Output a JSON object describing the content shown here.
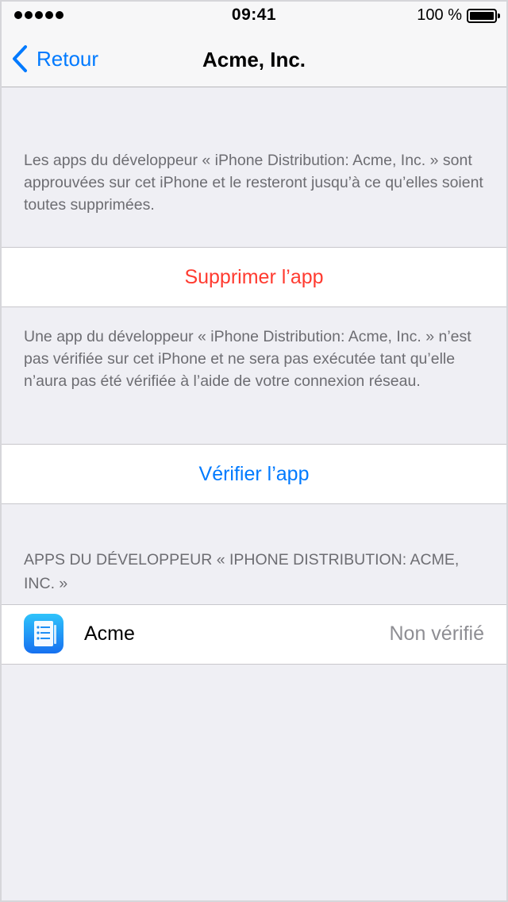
{
  "status_bar": {
    "time": "09:41",
    "battery_label": "100 %"
  },
  "nav": {
    "back_label": "Retour",
    "title": "Acme, Inc."
  },
  "trust_info": "Les apps du développeur « iPhone Distribution: Acme, Inc. » sont approuvées sur cet iPhone et le resteront jusqu’à ce qu’elles soient toutes supprimées.",
  "delete_button": "Supprimer l’app",
  "verify_info": "Une app du développeur « iPhone Distribution: Acme, Inc. » n’est pas vérifiée sur cet iPhone et ne sera pas exécutée tant qu’elle n’aura pas été vérifiée à l’aide de votre connexion réseau.",
  "verify_button": "Vérifier l’app",
  "apps_section": {
    "header": "APPS DU DÉVELOPPEUR « IPHONE DISTRIBUTION: ACME, INC. »",
    "items": [
      {
        "name": "Acme",
        "status": "Non vérifié",
        "icon": "notes-list-icon"
      }
    ]
  },
  "colors": {
    "accent": "#007aff",
    "destructive": "#ff3b30",
    "background": "#efeff4",
    "icon_top": "#2fc3fb",
    "icon_bottom": "#1670f0"
  }
}
